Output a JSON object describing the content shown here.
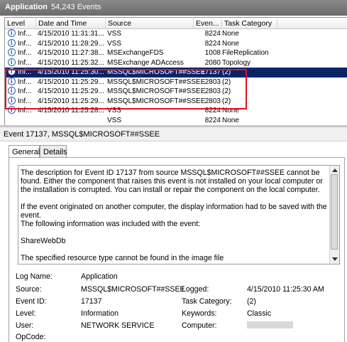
{
  "titlebar": {
    "title": "Application",
    "count": "54,243 Events"
  },
  "columns": [
    "Level",
    "Date and Time",
    "Source",
    "Even...",
    "Task Category"
  ],
  "rows": [
    {
      "level": "Inf...",
      "date": "4/15/2010 11:31:31...",
      "source": "VSS",
      "event": "8224",
      "task": "None"
    },
    {
      "level": "Inf...",
      "date": "4/15/2010 11:28:29...",
      "source": "VSS",
      "event": "8224",
      "task": "None"
    },
    {
      "level": "Inf...",
      "date": "4/15/2010 11:27:38...",
      "source": "MSExchangeFDS",
      "event": "1008",
      "task": "FileReplication"
    },
    {
      "level": "Inf...",
      "date": "4/15/2010 11:25:32...",
      "source": "MSExchange ADAccess",
      "event": "2080",
      "task": "Topology"
    },
    {
      "level": "Inf...",
      "date": "4/15/2010 11:25:30...",
      "source": "MSSQL$MICROSOFT##SSEE",
      "event": "17137",
      "task": "(2)"
    },
    {
      "level": "Inf...",
      "date": "4/15/2010 11:25:29...",
      "source": "MSSQL$MICROSOFT##SSEE",
      "event": "2803",
      "task": "(2)"
    },
    {
      "level": "Inf...",
      "date": "4/15/2010 11:25:29...",
      "source": "MSSQL$MICROSOFT##SSEE",
      "event": "2803",
      "task": "(2)"
    },
    {
      "level": "Inf...",
      "date": "4/15/2010 11:25:29...",
      "source": "MSSQL$MICROSOFT##SSEE",
      "event": "2803",
      "task": "(2)"
    },
    {
      "level": "Inf...",
      "date": "4/15/2010 11:25:28...",
      "source": "VSS",
      "event": "8224",
      "task": "None"
    },
    {
      "level": "",
      "date": "",
      "source": "VSS",
      "event": "8224",
      "task": "None"
    }
  ],
  "selected_row": 4,
  "detail": {
    "header": "Event 17137, MSSQL$MICROSOFT##SSEE",
    "tabs": [
      "General",
      "Details"
    ],
    "description": [
      "The description for Event ID 17137 from source MSSQL$MICROSOFT##SSEE cannot be found. Either the component that raises this event is not installed on your local computer or the installation is corrupted. You can install or repair the component on the local computer.",
      "If the event originated on another computer, the display information had to be saved with the event.",
      "The following information was included with the event:",
      "ShareWebDb",
      "The specified resource type cannot be found in the image file"
    ],
    "props": {
      "log_name_label": "Log Name:",
      "log_name": "Application",
      "source_label": "Source:",
      "source": "MSSQL$MICROSOFT##SSEE",
      "logged_label": "Logged:",
      "logged": "4/15/2010 11:25:30 AM",
      "event_id_label": "Event ID:",
      "event_id": "17137",
      "task_label": "Task Category:",
      "task": "(2)",
      "level_label": "Level:",
      "level": "Information",
      "keywords_label": "Keywords:",
      "keywords": "Classic",
      "user_label": "User:",
      "user": "NETWORK SERVICE",
      "computer_label": "Computer:",
      "opcode_label": "OpCode:"
    }
  },
  "colors": {
    "selection": "#0a246a",
    "highlight_box": "#e0141e",
    "info_icon": "#2a5db0"
  }
}
